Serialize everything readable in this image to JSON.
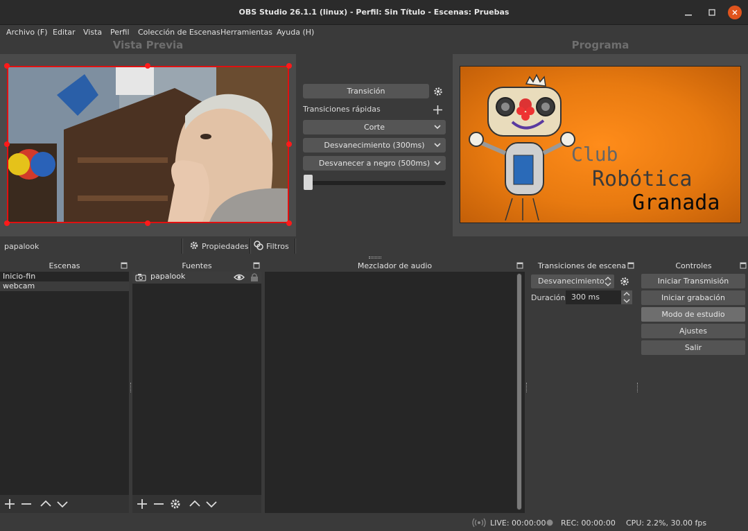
{
  "window": {
    "title": "OBS Studio 26.1.1 (linux) - Perfil: Sin Título - Escenas: Pruebas"
  },
  "menu": [
    "Archivo (F)",
    "Editar",
    "Vista",
    "Perfil",
    "Colección de Escenas",
    "Herramientas",
    "Ayuda (H)"
  ],
  "preview": {
    "label": "Vista Previa"
  },
  "program": {
    "label": "Programa",
    "logo_lines": [
      "Club",
      "Robótica",
      "Granada"
    ]
  },
  "transitions": {
    "transition_button": "Transición",
    "quick_label": "Transiciones rápidas",
    "quick": [
      "Corte",
      "Desvanecimiento (300ms)",
      "Desvanecer a negro (500ms)"
    ],
    "tbar_position": 0.0
  },
  "source_bar": {
    "selected": "papalook",
    "properties": "Propiedades",
    "filters": "Filtros"
  },
  "docks": {
    "scenes": {
      "title": "Escenas",
      "items": [
        "Inicio-fin",
        "webcam"
      ],
      "selected": "webcam"
    },
    "sources": {
      "title": "Fuentes",
      "items": [
        "papalook"
      ]
    },
    "mixer": {
      "title": "Mezclador de audio"
    },
    "scene_transitions": {
      "title": "Transiciones de escena",
      "selected": "Desvanecimiento",
      "duration_label": "Duración",
      "duration_value": "300 ms"
    },
    "controls": {
      "title": "Controles",
      "buttons": [
        "Iniciar Transmisión",
        "Iniciar grabación",
        "Modo de estudio",
        "Ajustes",
        "Salir"
      ]
    }
  },
  "status": {
    "live": "LIVE: 00:00:00",
    "rec": "REC: 00:00:00",
    "cpu": "CPU: 2.2%, 30.00 fps"
  },
  "colors": {
    "selection": "#e01010",
    "accent_orange": "#f08010",
    "active_button": "#6e6e6e"
  }
}
